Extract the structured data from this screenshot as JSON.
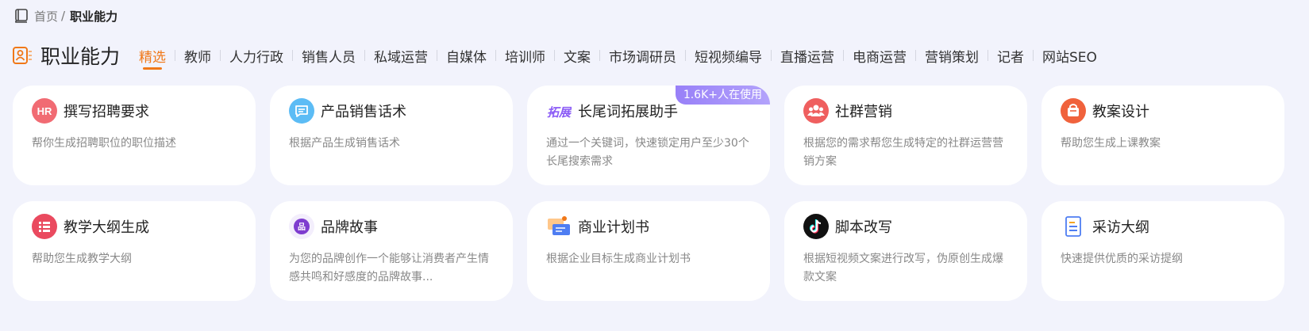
{
  "breadcrumb": {
    "home": "首页",
    "separator": "/",
    "current": "职业能力"
  },
  "header": {
    "title": "职业能力"
  },
  "tabs": [
    {
      "label": "精选",
      "active": true
    },
    {
      "label": "教师"
    },
    {
      "label": "人力行政"
    },
    {
      "label": "销售人员"
    },
    {
      "label": "私域运营"
    },
    {
      "label": "自媒体"
    },
    {
      "label": "培训师"
    },
    {
      "label": "文案"
    },
    {
      "label": "市场调研员"
    },
    {
      "label": "短视频编导"
    },
    {
      "label": "直播运营"
    },
    {
      "label": "电商运营"
    },
    {
      "label": "营销策划"
    },
    {
      "label": "记者"
    },
    {
      "label": "网站SEO"
    }
  ],
  "cards": [
    {
      "title": "撰写招聘要求",
      "desc": "帮你生成招聘职位的职位描述",
      "icon": "hr-icon",
      "color": "#f16b73"
    },
    {
      "title": "产品销售话术",
      "desc": "根据产品生成销售话术",
      "icon": "chat-icon",
      "color": "#5cbcf5"
    },
    {
      "title": "长尾词拓展助手",
      "desc": "通过一个关键词，快速锁定用户至少30个长尾搜索需求",
      "icon": "expand-logo-icon",
      "color": "#8b5cf6",
      "icon_text": "拓展",
      "badge": "1.6K+人在使用"
    },
    {
      "title": "社群营销",
      "desc": "根据您的需求帮您生成特定的社群运营营销方案",
      "icon": "group-icon",
      "color": "#ef5f5f"
    },
    {
      "title": "教案设计",
      "desc": "帮助您生成上课教案",
      "icon": "basket-icon",
      "color": "#f0623c"
    },
    {
      "title": "教学大纲生成",
      "desc": "帮助您生成教学大纲",
      "icon": "list-icon",
      "color": "#ea4a5f"
    },
    {
      "title": "品牌故事",
      "desc": "为您的品牌创作一个能够让消费者产生情感共鸣和好感度的品牌故事...",
      "icon": "brand-icon",
      "color": "#7e3ccf",
      "icon_text": "品"
    },
    {
      "title": "商业计划书",
      "desc": "根据企业目标生成商业计划书",
      "icon": "business-plan-icon",
      "color": "#4e7df2"
    },
    {
      "title": "脚本改写",
      "desc": "根据短视频文案进行改写，伪原创生成爆款文案",
      "icon": "tiktok-icon",
      "color": "#111111"
    },
    {
      "title": "采访大纲",
      "desc": "快速提供优质的采访提纲",
      "icon": "document-icon",
      "color": "#4e7df2"
    }
  ],
  "colors": {
    "accent": "#f07818",
    "background": "#f2f3fc",
    "badge": "#9b85f8"
  }
}
